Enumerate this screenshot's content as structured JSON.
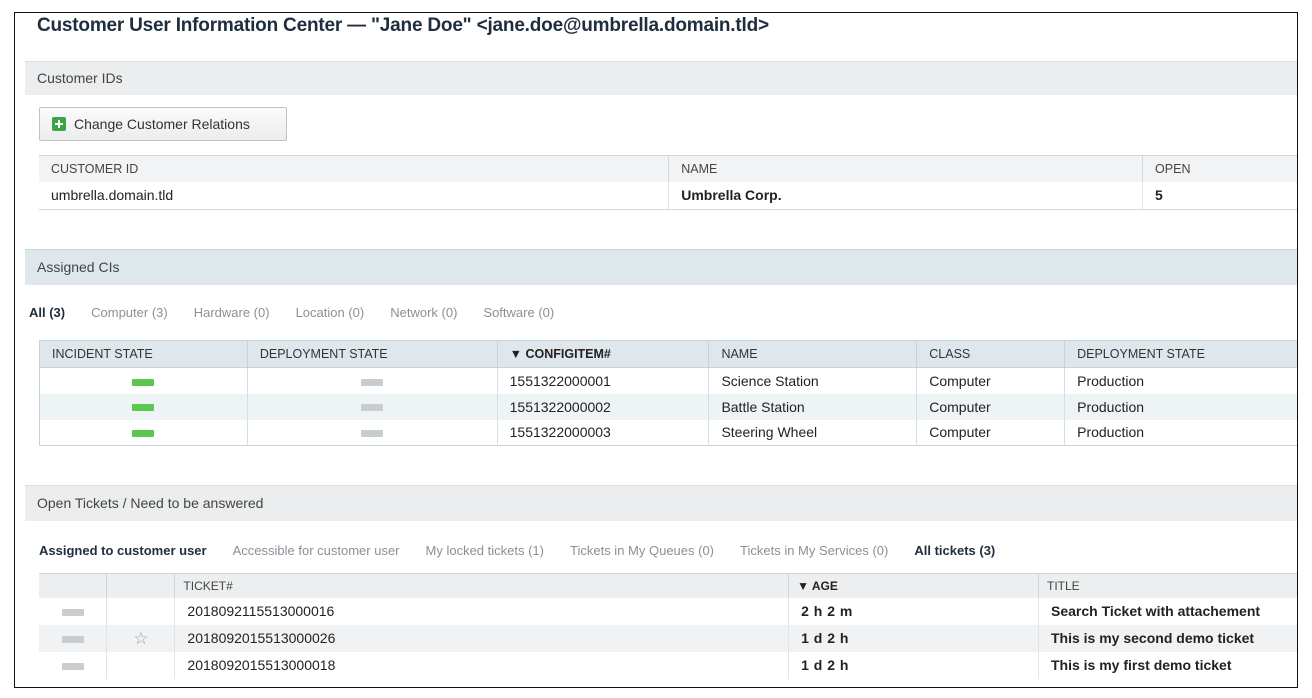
{
  "page": {
    "title": "Customer User Information Center — \"Jane Doe\" <jane.doe@umbrella.domain.tld>"
  },
  "customer_ids": {
    "header": "Customer IDs",
    "button_label": "Change Customer Relations",
    "button_icon": "plus-icon",
    "columns": [
      "CUSTOMER ID",
      "NAME",
      "OPEN"
    ],
    "rows": [
      {
        "customer_id": "umbrella.domain.tld",
        "name": "Umbrella Corp.",
        "open": "5"
      }
    ]
  },
  "assigned_cis": {
    "header": "Assigned CIs",
    "tabs": [
      "All (3)",
      "Computer (3)",
      "Hardware (0)",
      "Location (0)",
      "Network (0)",
      "Software (0)"
    ],
    "active_tab": "All (3)",
    "columns": [
      "INCIDENT STATE",
      "DEPLOYMENT STATE",
      "▼ CONFIGITEM#",
      "NAME",
      "CLASS",
      "DEPLOYMENT STATE"
    ],
    "rows": [
      {
        "incident_color": "#5cc74e",
        "deployment_color": "#c9cdd0",
        "configitem": "1551322000001",
        "name": "Science Station",
        "class": "Computer",
        "deployment_state": "Production"
      },
      {
        "incident_color": "#5cc74e",
        "deployment_color": "#c9cdd0",
        "configitem": "1551322000002",
        "name": "Battle Station",
        "class": "Computer",
        "deployment_state": "Production"
      },
      {
        "incident_color": "#5cc74e",
        "deployment_color": "#c9cdd0",
        "configitem": "1551322000003",
        "name": "Steering Wheel",
        "class": "Computer",
        "deployment_state": "Production"
      }
    ]
  },
  "open_tickets": {
    "header": "Open Tickets / Need to be answered",
    "tabs": [
      "Assigned to customer user",
      "Accessible for customer user",
      "My locked tickets (1)",
      "Tickets in My Queues (0)",
      "Tickets in My Services (0)",
      "All tickets (3)"
    ],
    "active_tabs": [
      "Assigned to customer user",
      "All tickets (3)"
    ],
    "columns": [
      "",
      "",
      "TICKET#",
      "▼ AGE",
      "TITLE"
    ],
    "rows": [
      {
        "priority_color": "#c9cdd0",
        "starred": false,
        "ticket": "2018092115513000016",
        "age": "2 h 2 m",
        "title": "Search Ticket with attachement"
      },
      {
        "priority_color": "#c9cdd0",
        "starred": true,
        "ticket": "2018092015513000026",
        "age": "1 d 2 h",
        "title": "This is my second demo ticket"
      },
      {
        "priority_color": "#c9cdd0",
        "starred": false,
        "ticket": "2018092015513000018",
        "age": "1 d 2 h",
        "title": "This is my first demo ticket"
      }
    ],
    "star_glyph": "☆"
  }
}
